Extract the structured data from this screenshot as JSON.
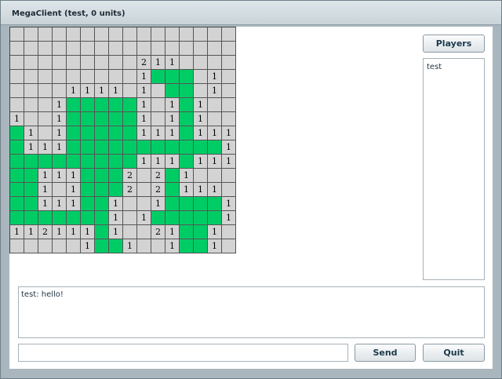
{
  "window": {
    "title": "MegaClient (test, 0 units)"
  },
  "players_button_label": "Players",
  "players": [
    "test"
  ],
  "chat": {
    "lines": [
      "test: hello!"
    ],
    "input_value": "",
    "input_placeholder": ""
  },
  "send_label": "Send",
  "quit_label": "Quit",
  "colors": {
    "unit_green": "#00cc66",
    "cell_gray": "#d3d3d3"
  },
  "board_legend": {
    "H": "hidden",
    "O": "open-empty",
    "G": "green-unit",
    "digit": "open-with-count"
  },
  "board_rows": [
    "HHHHHHHHHHHHHHHH",
    "HHHHHHHHHHHHHHHH",
    "HHHHHHHHH211HHHH",
    "HHHHHHHHO1GGGO1H",
    "HHHO1111O1OGGO1H",
    "HHO1GGGGG1O1G1HH",
    "1OO1GGGGG1O1G1HH",
    "G1O1GGGGG111G111",
    "G111GGGGGGGGGGG1",
    "GGGGGGGGG111G111",
    "GG111GGG2O2G1HHH",
    "GG1O1GGG2O2G111H",
    "GG111GG1OO1GGGG1",
    "GGGGGGG1O1GGGGG1",
    "112111G1OO21GG1H",
    "HHHHH1GG1HH1GG1H"
  ]
}
